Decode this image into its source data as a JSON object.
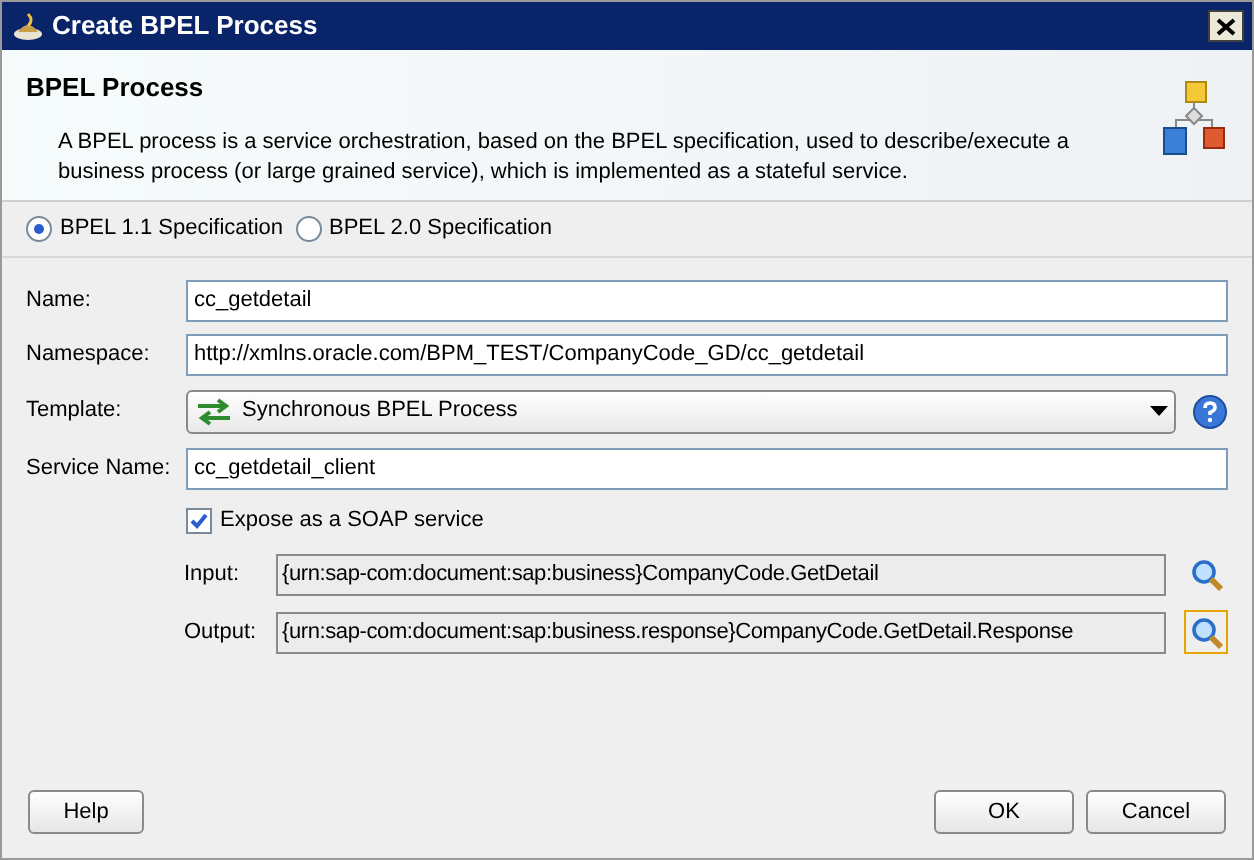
{
  "window": {
    "title": "Create BPEL Process"
  },
  "header": {
    "title": "BPEL Process",
    "description": "A BPEL process is a service orchestration, based on the BPEL specification, used to describe/execute a business process (or large grained service), which is implemented as a stateful service."
  },
  "spec_options": [
    {
      "label": "BPEL 1.1 Specification",
      "selected": true
    },
    {
      "label": "BPEL 2.0 Specification",
      "selected": false
    }
  ],
  "fields": [
    {
      "label": "Name:",
      "value": "cc_getdetail"
    },
    {
      "label": "Namespace:",
      "value": "http://xmlns.oracle.com/BPM_TEST/CompanyCode_GD/cc_getdetail"
    }
  ],
  "template": {
    "label": "Template:",
    "value": "Synchronous BPEL Process"
  },
  "service_name": {
    "label": "Service Name:",
    "value": "cc_getdetail_client"
  },
  "expose_soap": {
    "label": "Expose as a SOAP service",
    "checked": true
  },
  "messages": [
    {
      "label": "Input:",
      "value": "{urn:sap-com:document:sap:business}CompanyCode.GetDetail",
      "focused": false
    },
    {
      "label": "Output:",
      "value": "{urn:sap-com:document:sap:business.response}CompanyCode.GetDetail.Response",
      "focused": true
    }
  ],
  "buttons": {
    "help": "Help",
    "ok": "OK",
    "cancel": "Cancel"
  }
}
